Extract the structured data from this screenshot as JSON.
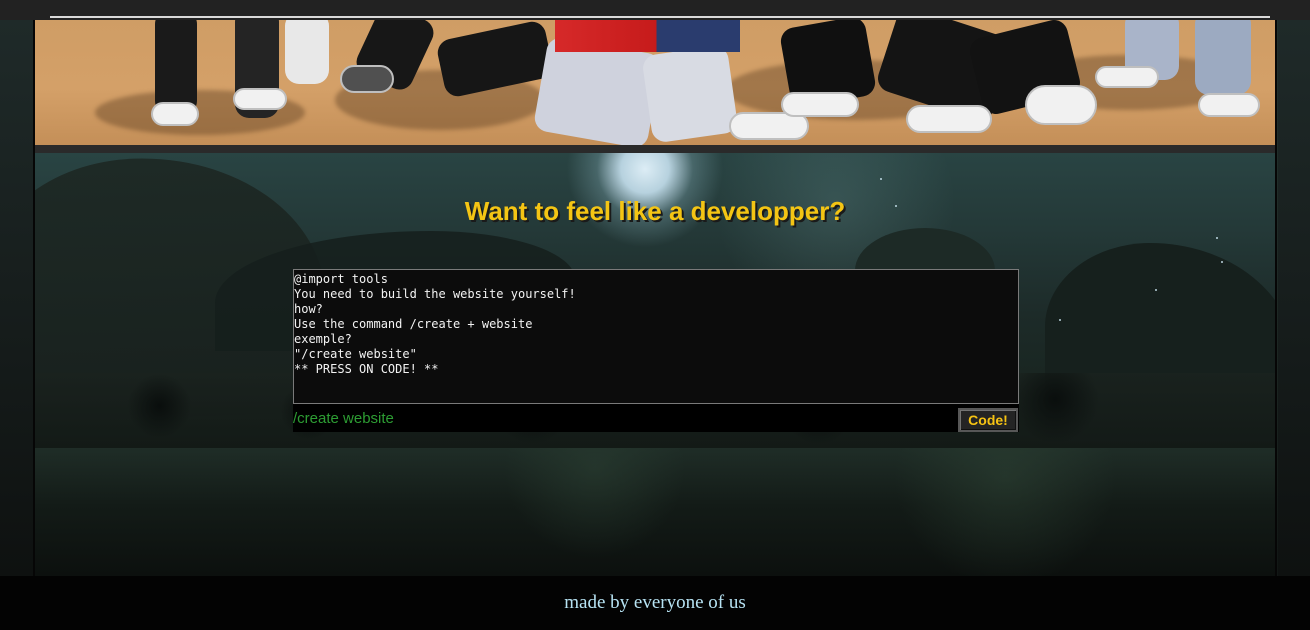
{
  "main": {
    "headline": "Want to feel like a developper?",
    "terminal_lines": [
      "@import tools",
      "You need to build the website yourself!",
      "how?",
      "Use the command /create + website",
      "exemple?",
      "\"/create website\"",
      "** PRESS ON CODE! **"
    ],
    "command_input": {
      "value": "/create website",
      "placeholder": ""
    },
    "code_button_label": "Code!"
  },
  "footer": {
    "text": "made by everyone of us"
  },
  "colors": {
    "accent_yellow": "#f4c514",
    "command_green": "#2d9d33",
    "footer_text": "#b7e3f3"
  }
}
